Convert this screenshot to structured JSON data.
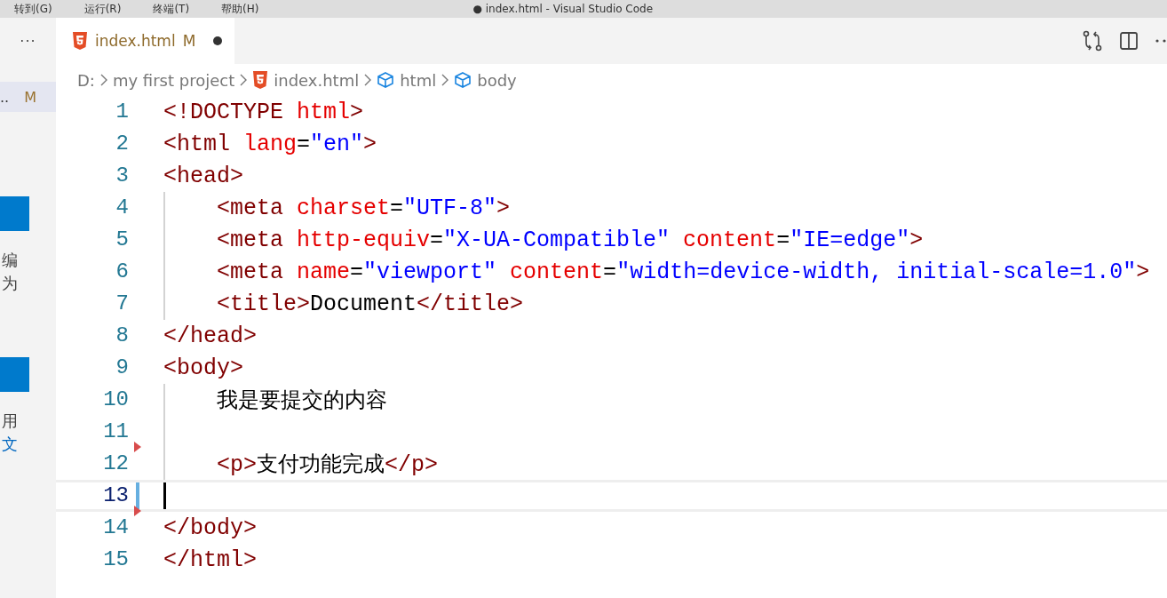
{
  "menu": [
    "转到(G)",
    "运行(R)",
    "终端(T)",
    "帮助(H)"
  ],
  "window": {
    "title": "● index.html - Visual Studio Code"
  },
  "sidebar": {
    "more": "···",
    "item": {
      "label": "..",
      "badge": "M"
    },
    "fragments": [
      {
        "kind": "button"
      },
      {
        "kind": "text",
        "lines": [
          "编",
          "为"
        ]
      },
      {
        "kind": "button"
      },
      {
        "kind": "text",
        "lines": [
          "用",
          "文"
        ]
      }
    ]
  },
  "tab": {
    "label": "index.html",
    "badge": "M",
    "dirty": true,
    "selected": true
  },
  "breadcrumbs": [
    {
      "kind": "plain",
      "label": "D:"
    },
    {
      "kind": "plain",
      "label": "my first project"
    },
    {
      "kind": "html5",
      "label": "index.html"
    },
    {
      "kind": "symbol",
      "label": "html"
    },
    {
      "kind": "symbol",
      "label": "body"
    }
  ],
  "lines": [
    {
      "number": "1",
      "guide": false,
      "current": false,
      "deleted_above": false,
      "modified": false,
      "tokens": [
        {
          "kind": "tag",
          "text": "<!DOCTYPE "
        },
        {
          "kind": "attr",
          "text": "html"
        },
        {
          "kind": "tag",
          "text": ">"
        }
      ]
    },
    {
      "number": "2",
      "guide": false,
      "current": false,
      "deleted_above": false,
      "modified": false,
      "tokens": [
        {
          "kind": "tag",
          "text": "<html "
        },
        {
          "kind": "attr",
          "text": "lang"
        },
        {
          "kind": "text",
          "text": "="
        },
        {
          "kind": "value",
          "text": "\"en\""
        },
        {
          "kind": "tag",
          "text": ">"
        }
      ]
    },
    {
      "number": "3",
      "guide": false,
      "current": false,
      "deleted_above": false,
      "modified": false,
      "tokens": [
        {
          "kind": "tag",
          "text": "<head>"
        }
      ]
    },
    {
      "number": "4",
      "guide": true,
      "current": false,
      "deleted_above": false,
      "modified": false,
      "tokens": [
        {
          "kind": "tag",
          "text": "<meta "
        },
        {
          "kind": "attr",
          "text": "charset"
        },
        {
          "kind": "text",
          "text": "="
        },
        {
          "kind": "value",
          "text": "\"UTF-8\""
        },
        {
          "kind": "tag",
          "text": ">"
        }
      ]
    },
    {
      "number": "5",
      "guide": true,
      "current": false,
      "deleted_above": false,
      "modified": false,
      "tokens": [
        {
          "kind": "tag",
          "text": "<meta "
        },
        {
          "kind": "attr",
          "text": "http-equiv"
        },
        {
          "kind": "text",
          "text": "="
        },
        {
          "kind": "value",
          "text": "\"X-UA-Compatible\" "
        },
        {
          "kind": "attr",
          "text": "content"
        },
        {
          "kind": "text",
          "text": "="
        },
        {
          "kind": "value",
          "text": "\"IE=edge\""
        },
        {
          "kind": "tag",
          "text": ">"
        }
      ]
    },
    {
      "number": "6",
      "guide": true,
      "current": false,
      "deleted_above": false,
      "modified": false,
      "tokens": [
        {
          "kind": "tag",
          "text": "<meta "
        },
        {
          "kind": "attr",
          "text": "name"
        },
        {
          "kind": "text",
          "text": "="
        },
        {
          "kind": "value",
          "text": "\"viewport\" "
        },
        {
          "kind": "attr",
          "text": "content"
        },
        {
          "kind": "text",
          "text": "="
        },
        {
          "kind": "value",
          "text": "\"width=device-width, initial-scale=1.0\""
        },
        {
          "kind": "tag",
          "text": ">"
        }
      ]
    },
    {
      "number": "7",
      "guide": true,
      "current": false,
      "deleted_above": false,
      "modified": false,
      "tokens": [
        {
          "kind": "tag",
          "text": "<title>"
        },
        {
          "kind": "text",
          "text": "Document"
        },
        {
          "kind": "tag",
          "text": "</title>"
        }
      ]
    },
    {
      "number": "8",
      "guide": false,
      "current": false,
      "deleted_above": false,
      "modified": false,
      "tokens": [
        {
          "kind": "tag",
          "text": "</head>"
        }
      ]
    },
    {
      "number": "9",
      "guide": false,
      "current": false,
      "deleted_above": false,
      "modified": false,
      "tokens": [
        {
          "kind": "tag",
          "text": "<body>"
        }
      ]
    },
    {
      "number": "10",
      "guide": true,
      "current": false,
      "deleted_above": false,
      "modified": false,
      "tokens": [
        {
          "kind": "cjk",
          "text": "我是要提交的内容"
        }
      ]
    },
    {
      "number": "11",
      "guide": true,
      "current": false,
      "deleted_above": false,
      "modified": false
    },
    {
      "number": "12",
      "guide": true,
      "current": false,
      "deleted_above": true,
      "modified": false,
      "tokens": [
        {
          "kind": "tag",
          "text": "<p>"
        },
        {
          "kind": "cjk",
          "text": "支付功能完成"
        },
        {
          "kind": "tag",
          "text": "</p>"
        }
      ]
    },
    {
      "number": "13",
      "guide": false,
      "current": true,
      "deleted_above": false,
      "modified": true
    },
    {
      "number": "14",
      "guide": false,
      "current": false,
      "deleted_above": true,
      "modified": false,
      "tokens": [
        {
          "kind": "tag",
          "text": "</body>"
        }
      ]
    },
    {
      "number": "15",
      "guide": false,
      "current": false,
      "deleted_above": false,
      "modified": false,
      "tokens": [
        {
          "kind": "tag",
          "text": "</html>"
        }
      ]
    }
  ]
}
